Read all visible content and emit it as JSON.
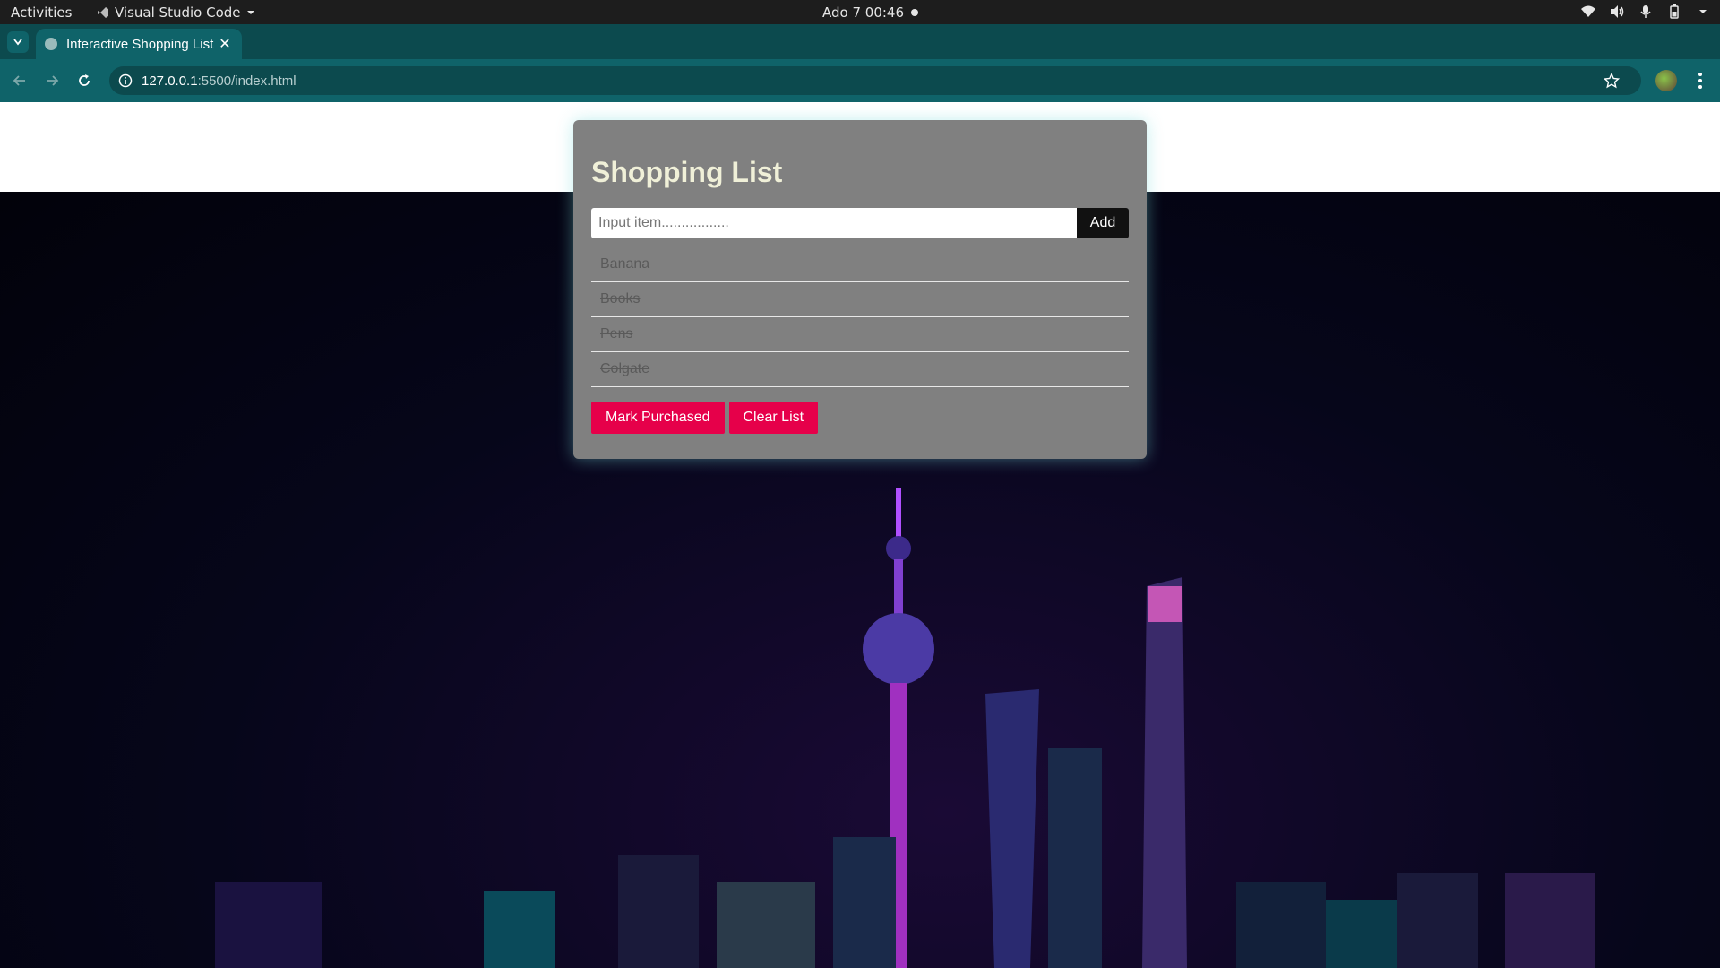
{
  "system_bar": {
    "activities": "Activities",
    "app_name": "Visual Studio Code",
    "clock": "Ado 7  00:46"
  },
  "browser": {
    "tab_title": "Interactive Shopping List",
    "url_host": "127.0.0.1",
    "url_rest": ":5500/index.html",
    "theme_color": "#0f6369"
  },
  "app": {
    "title": "Shopping List",
    "input_placeholder": "Input item.................",
    "add_label": "Add",
    "items": [
      {
        "label": "Banana",
        "purchased": true
      },
      {
        "label": "Books",
        "purchased": true
      },
      {
        "label": "Pens",
        "purchased": true
      },
      {
        "label": "Colgate",
        "purchased": true
      }
    ],
    "mark_purchased_label": "Mark Purchased",
    "clear_list_label": "Clear List",
    "accent_color": "#e6004a"
  }
}
